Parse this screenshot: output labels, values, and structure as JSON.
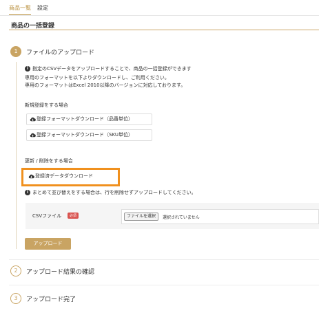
{
  "tabs": [
    {
      "label": "商品一覧",
      "active": true
    },
    {
      "label": "設定",
      "active": false
    }
  ],
  "page_title": "商品の一括登録",
  "colors": {
    "accent": "#c9a463",
    "highlight": "#f0901e",
    "required": "#d9534f"
  },
  "steps": [
    {
      "number": "1",
      "label": "ファイルのアップロード"
    },
    {
      "number": "2",
      "label": "アップロード結果の確認"
    },
    {
      "number": "3",
      "label": "アップロード完了"
    }
  ],
  "info": {
    "line1": "指定のCSVデータをアップロードすることで、商品の一括登録ができます",
    "line2": "専用のフォーマットを以下よりダウンロードし、ご利用ください。",
    "line3": "専用のフォーマットはExcel 2010以降のバージョンに対応しております。"
  },
  "new_registration": {
    "heading": "新規登録をする場合",
    "btn_product": "登録フォーマットダウンロード（品番単位）",
    "btn_sku": "登録フォーマットダウンロード（SKU単位）"
  },
  "update_delete": {
    "heading": "更新 / 削除をする場合",
    "btn_registered": "登録済データダウンロード",
    "note": "まとめて並び替えをする場合は、行を削除せずアップロードしてください。"
  },
  "csv": {
    "label": "CSVファイル",
    "required": "必須",
    "select_button": "ファイルを選択",
    "no_file": "選択されていません"
  },
  "upload_button": "アップロード",
  "icons": {
    "info": "info-circle-icon",
    "download": "cloud-download-icon"
  }
}
